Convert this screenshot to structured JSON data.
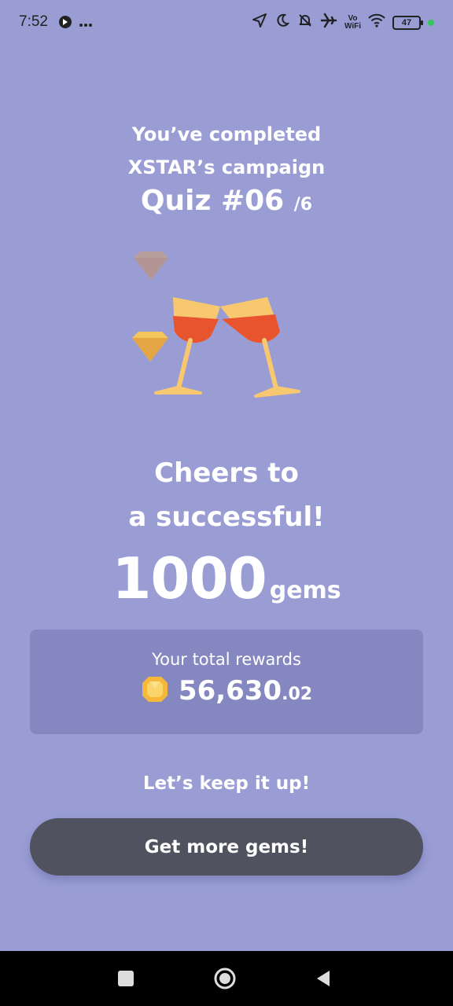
{
  "status_bar": {
    "time": "7:52",
    "battery": "47",
    "vowifi_top": "Vo",
    "vowifi_bottom": "WiFi"
  },
  "header": {
    "line1": "You’ve completed",
    "line2": "XSTAR’s campaign",
    "quiz_label": "Quiz #06",
    "quiz_total": "/6"
  },
  "message": {
    "line1": "Cheers to",
    "line2": "a successful!"
  },
  "reward": {
    "amount": "1000",
    "unit": "gems"
  },
  "total_rewards": {
    "label": "Your total rewards",
    "value_main": "56,630",
    "value_decimal": ".02"
  },
  "footer": {
    "encouragement": "Let’s keep it up!",
    "cta_label": "Get more gems!"
  },
  "colors": {
    "background": "#999dd4",
    "card": "#8588c0",
    "button": "#50535f",
    "gem": "#f5c24f",
    "wine": "#e8542e"
  },
  "icons": [
    "location-icon",
    "moon-icon",
    "bell-off-icon",
    "airplane-icon",
    "wifi-icon",
    "battery-icon",
    "gem-icon",
    "square-nav-icon",
    "home-nav-icon",
    "back-nav-icon"
  ]
}
